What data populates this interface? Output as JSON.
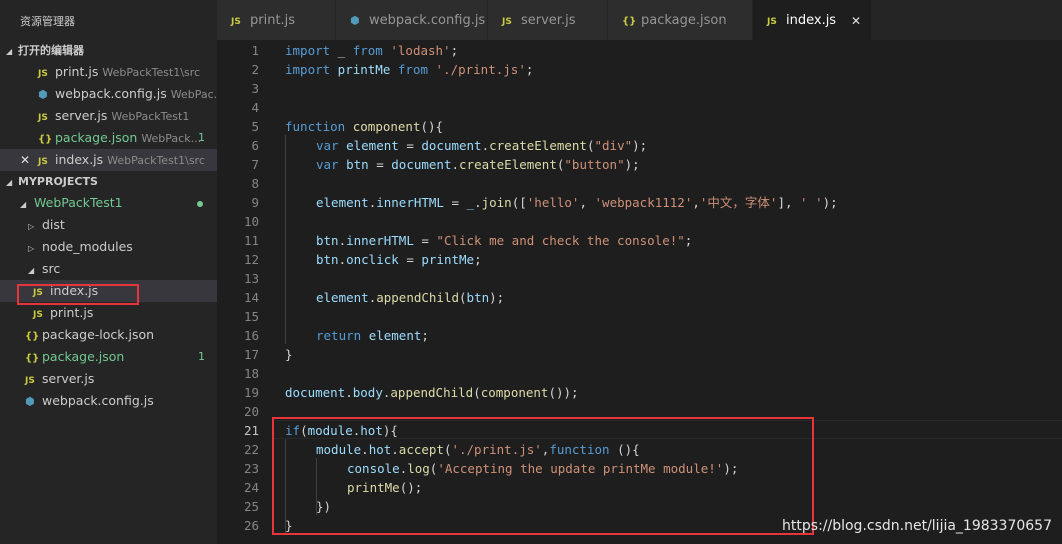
{
  "sidebar": {
    "title": "资源管理器",
    "open_editors_label": "打开的编辑器",
    "open_editors": [
      {
        "icon": "js-file-icon",
        "name": "print.js",
        "desc": "WebPackTest1\\src",
        "badge": ""
      },
      {
        "icon": "webpack-cube-icon",
        "name": "webpack.config.js",
        "desc": "WebPac...",
        "badge": ""
      },
      {
        "icon": "js-file-icon",
        "name": "server.js",
        "desc": "WebPackTest1",
        "badge": ""
      },
      {
        "icon": "json-braces-icon",
        "name": "package.json",
        "desc": "WebPack...",
        "badge": "1"
      },
      {
        "icon": "js-file-icon",
        "name": "index.js",
        "desc": "WebPackTest1\\src",
        "badge": ""
      }
    ],
    "project_label": "MYPROJECTS",
    "tree": {
      "root": "WebPackTest1",
      "dist": "dist",
      "node_modules": "node_modules",
      "src": "src",
      "index": "index.js",
      "print": "print.js",
      "package_lock": "package-lock.json",
      "package_json": "package.json",
      "package_json_badge": "1",
      "server": "server.js",
      "webpack_config": "webpack.config.js"
    }
  },
  "icons": {
    "js_label": "JS",
    "json_label": "{}",
    "cube_glyph": "⬢",
    "close_glyph": "✕",
    "tri_open": "◢",
    "tri_closed": "▷"
  },
  "tabs": [
    {
      "label": "print.js",
      "icon": "js-file-icon"
    },
    {
      "label": "webpack.config.js",
      "icon": "webpack-cube-icon"
    },
    {
      "label": "server.js",
      "icon": "js-file-icon"
    },
    {
      "label": "package.json",
      "icon": "json-braces-icon"
    },
    {
      "label": "index.js",
      "icon": "js-file-icon"
    }
  ],
  "editor": {
    "current_line": "21",
    "lines": [
      "1",
      "2",
      "3",
      "4",
      "5",
      "6",
      "7",
      "8",
      "9",
      "10",
      "11",
      "12",
      "13",
      "14",
      "15",
      "16",
      "17",
      "18",
      "19",
      "20",
      "21",
      "22",
      "23",
      "24",
      "25",
      "26"
    ],
    "code": {
      "l1": [
        "import",
        " _ ",
        "from",
        " ",
        "'lodash'",
        ";"
      ],
      "l2": [
        "import",
        " printMe ",
        "from",
        " ",
        "'./print.js'",
        ";"
      ],
      "l5": [
        "function",
        " ",
        "component",
        "(){"
      ],
      "l6": [
        "var",
        " ",
        "element",
        " = ",
        "document",
        ".",
        "createElement",
        "(",
        "\"div\"",
        ");"
      ],
      "l7": [
        "var",
        " ",
        "btn",
        " = ",
        "document",
        ".",
        "createElement",
        "(",
        "\"button\"",
        ");"
      ],
      "l9": [
        "element",
        ".",
        "innerHTML",
        " = ",
        "_",
        ".",
        "join",
        "([",
        "'hello'",
        ", ",
        "'webpack1112'",
        ",",
        "'中文，字体'",
        "], ",
        "' '",
        ");"
      ],
      "l11": [
        "btn",
        ".",
        "innerHTML",
        " = ",
        "\"Click me and check the console!\"",
        ";"
      ],
      "l12": [
        "btn",
        ".",
        "onclick",
        " = ",
        "printMe",
        ";"
      ],
      "l14": [
        "element",
        ".",
        "appendChild",
        "(",
        "btn",
        ");"
      ],
      "l16": [
        "return",
        " ",
        "element",
        ";"
      ],
      "l17": [
        "}"
      ],
      "l19": [
        "document",
        ".",
        "body",
        ".",
        "appendChild",
        "(",
        "component",
        "());"
      ],
      "l21": [
        "if",
        "(",
        "module",
        ".",
        "hot",
        "){"
      ],
      "l22": [
        "module",
        ".",
        "hot",
        ".",
        "accept",
        "(",
        "'./print.js'",
        ",",
        "function",
        " (){"
      ],
      "l23": [
        "console",
        ".",
        "log",
        "(",
        "'Accepting the update printMe module!'",
        ");"
      ],
      "l24": [
        "printMe",
        "();"
      ],
      "l25": [
        "})"
      ],
      "l26": [
        "}"
      ]
    }
  },
  "watermark": "https://blog.csdn.net/lijia_1983370657",
  "colors": {
    "keyword": "#569cd6",
    "string": "#ce9178",
    "function": "#dcdcaa",
    "variable": "#9cdcfe",
    "highlight_box": "#e8343b",
    "git_modified": "#73c991"
  }
}
